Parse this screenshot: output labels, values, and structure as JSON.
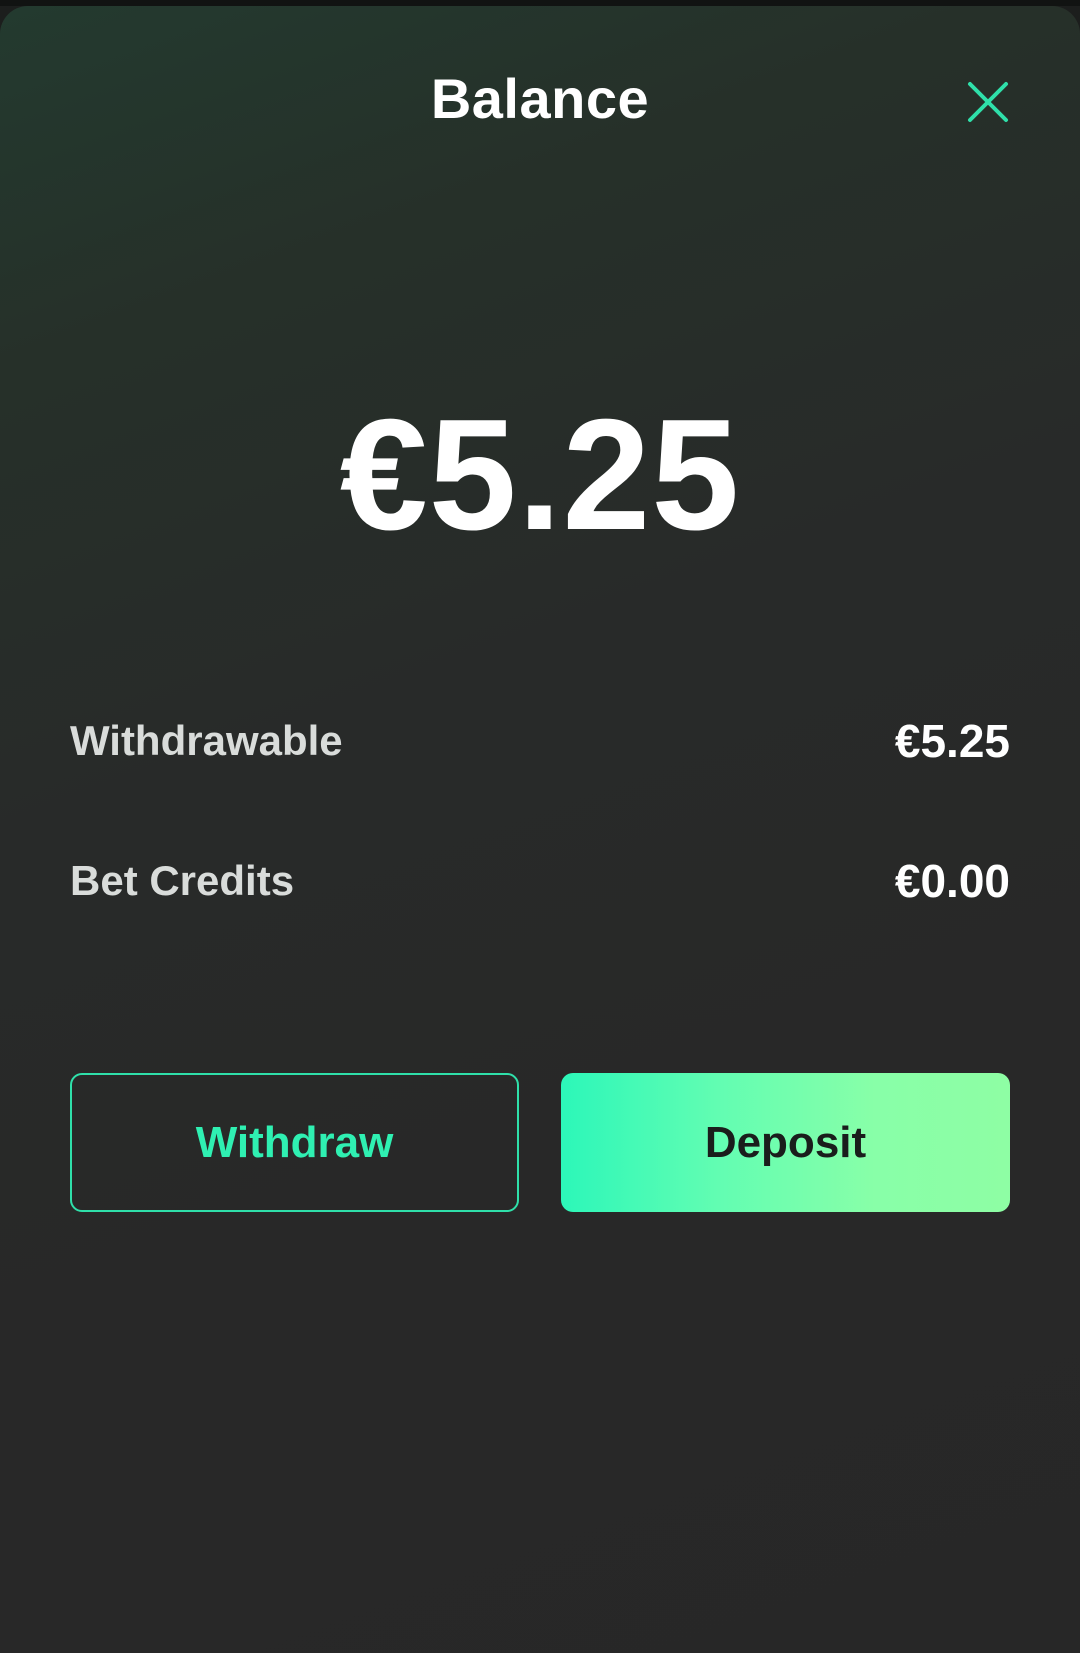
{
  "header": {
    "title": "Balance",
    "close_icon": "close-icon"
  },
  "balance": {
    "total": "€5.25"
  },
  "breakdown": [
    {
      "label": "Withdrawable",
      "value": "€5.25"
    },
    {
      "label": "Bet Credits",
      "value": "€0.00"
    }
  ],
  "actions": {
    "withdraw_label": "Withdraw",
    "deposit_label": "Deposit"
  },
  "colors": {
    "accent": "#2FE0AA",
    "deposit_gradient_start": "#2CF7B9",
    "deposit_gradient_end": "#8EFEA4",
    "background": "#282828"
  }
}
